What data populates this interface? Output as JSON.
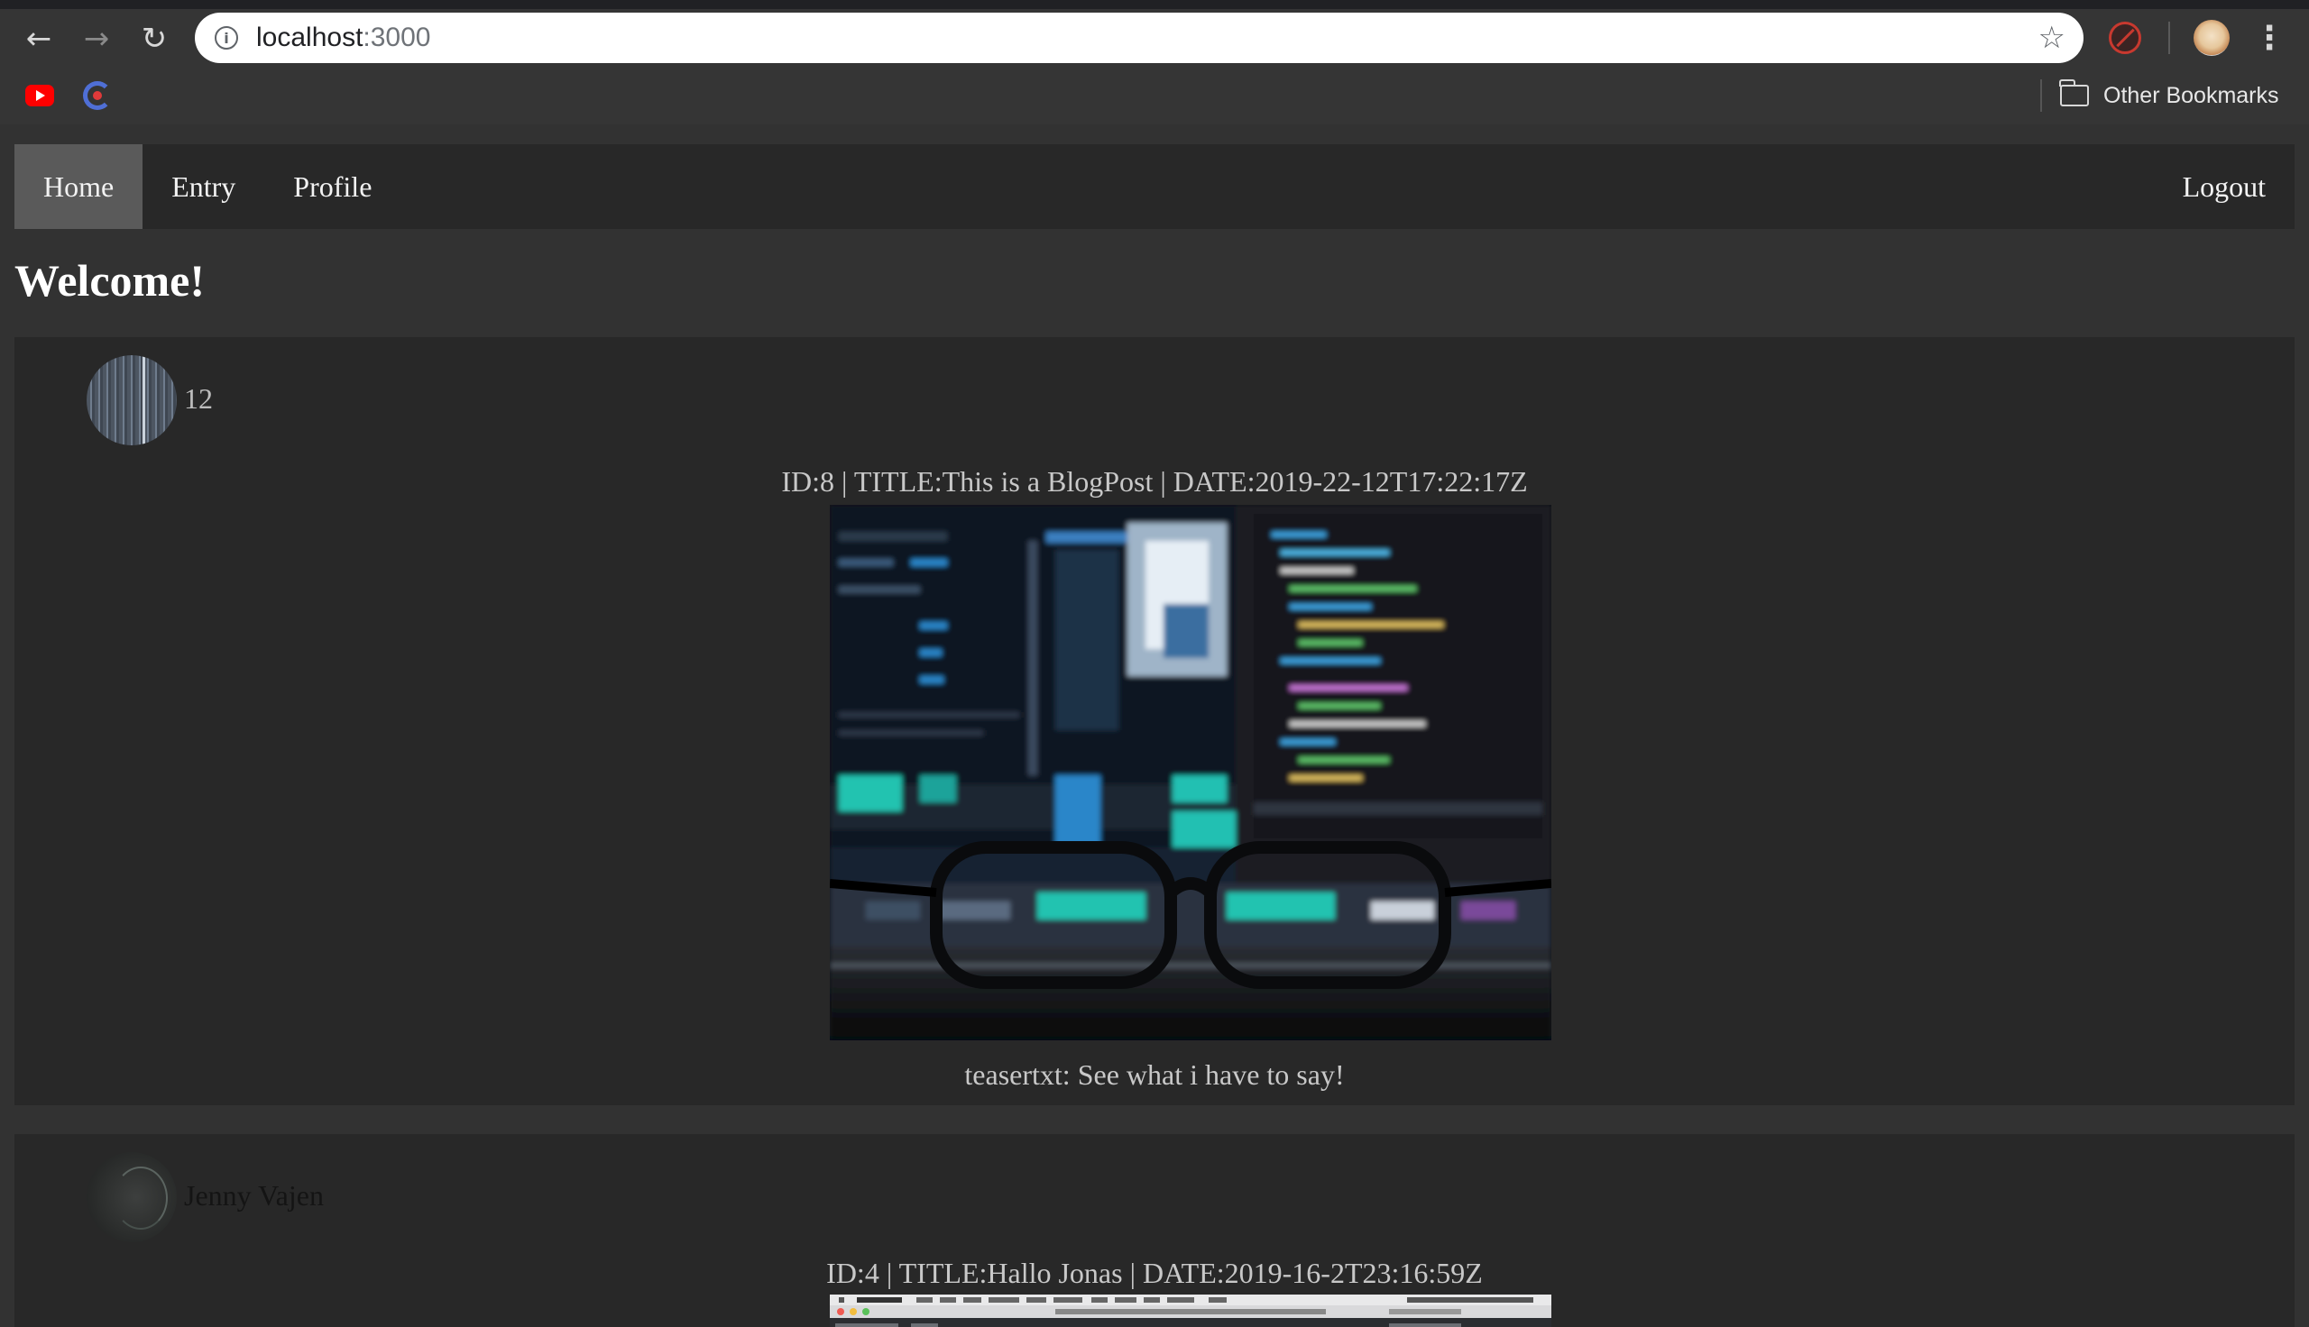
{
  "browser": {
    "url_host": "localhost",
    "url_port": ":3000",
    "bookmarks_other_label": "Other Bookmarks"
  },
  "nav": {
    "home": "Home",
    "entry": "Entry",
    "profile": "Profile",
    "logout": "Logout"
  },
  "heading": "Welcome!",
  "posts": [
    {
      "author": "12",
      "meta": "ID:8 | TITLE:This is a BlogPost | DATE:2019-22-12T17:22:17Z",
      "teaser": "teasertxt: See what i have to say!"
    },
    {
      "author": "Jenny Vajen",
      "meta": "ID:4 | TITLE:Hallo Jonas | DATE:2019-16-2T23:16:59Z"
    }
  ],
  "colors": {
    "page_bg": "#323232",
    "card_bg": "#282828",
    "nav_active": "#5a5a5a"
  }
}
